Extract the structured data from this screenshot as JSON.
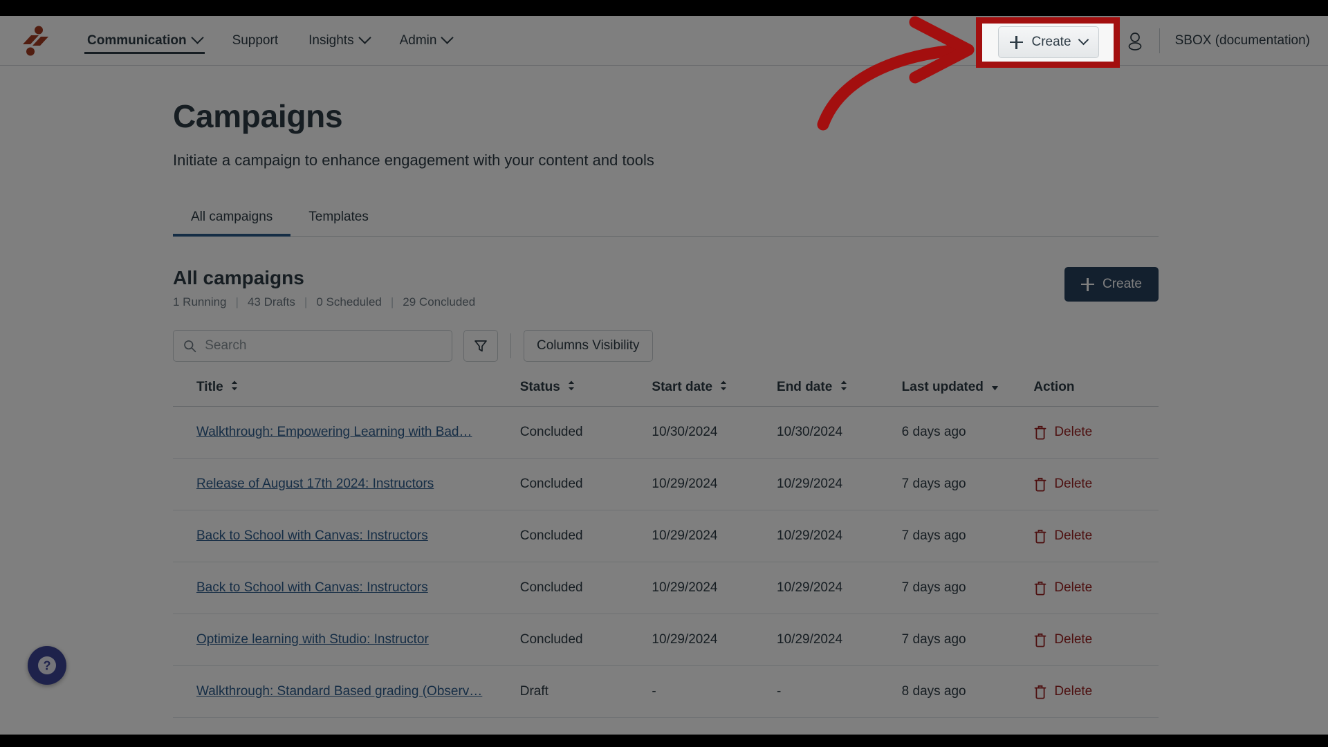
{
  "topnav": {
    "brand_icon": "brand-logo-icon",
    "links": [
      {
        "label": "Communication",
        "has_caret": true,
        "active": true
      },
      {
        "label": "Support",
        "has_caret": false,
        "active": false
      },
      {
        "label": "Insights",
        "has_caret": true,
        "active": false
      },
      {
        "label": "Admin",
        "has_caret": true,
        "active": false
      }
    ],
    "create_label": "Create",
    "account_name": "SBOX (documentation)"
  },
  "page": {
    "title": "Campaigns",
    "subtitle": "Initiate a campaign to enhance engagement with your content and tools",
    "tabs": [
      {
        "label": "All campaigns",
        "active": true
      },
      {
        "label": "Templates",
        "active": false
      }
    ],
    "section_title": "All campaigns",
    "stats": [
      "1 Running",
      "43 Drafts",
      "0 Scheduled",
      "29 Concluded"
    ],
    "stats_separator": "|",
    "create_button_label": "Create"
  },
  "toolbar": {
    "search_placeholder": "Search",
    "search_value": "",
    "filter_icon": "filter-funnel-icon",
    "columns_visibility_label": "Columns Visibility"
  },
  "table": {
    "columns": [
      {
        "label": "Title",
        "sort": "both"
      },
      {
        "label": "Status",
        "sort": "both"
      },
      {
        "label": "Start date",
        "sort": "both"
      },
      {
        "label": "End date",
        "sort": "both"
      },
      {
        "label": "Last updated",
        "sort": "desc"
      },
      {
        "label": "Action",
        "sort": "none"
      }
    ],
    "rows": [
      {
        "title": "Walkthrough: Empowering Learning with Bad…",
        "status": "Concluded",
        "start_date": "10/30/2024",
        "end_date": "10/30/2024",
        "last_updated": "6 days ago",
        "action": "Delete"
      },
      {
        "title": "Release of August 17th 2024: Instructors",
        "status": "Concluded",
        "start_date": "10/29/2024",
        "end_date": "10/29/2024",
        "last_updated": "7 days ago",
        "action": "Delete"
      },
      {
        "title": "Back to School with Canvas: Instructors",
        "status": "Concluded",
        "start_date": "10/29/2024",
        "end_date": "10/29/2024",
        "last_updated": "7 days ago",
        "action": "Delete"
      },
      {
        "title": "Back to School with Canvas: Instructors",
        "status": "Concluded",
        "start_date": "10/29/2024",
        "end_date": "10/29/2024",
        "last_updated": "7 days ago",
        "action": "Delete"
      },
      {
        "title": "Optimize learning with Studio: Instructor",
        "status": "Concluded",
        "start_date": "10/29/2024",
        "end_date": "10/29/2024",
        "last_updated": "7 days ago",
        "action": "Delete"
      },
      {
        "title": "Walkthrough: Standard Based grading (Observ…",
        "status": "Draft",
        "start_date": "-",
        "end_date": "-",
        "last_updated": "8 days ago",
        "action": "Delete"
      }
    ]
  },
  "help": {
    "icon": "question-mark-icon"
  },
  "annotation": {
    "highlight_target": "create-button-top",
    "create_label": "Create",
    "arrow_color": "#a30f0f",
    "box_color": "#a30f0f"
  },
  "colors": {
    "brand": "#a33b21",
    "link": "#2b5a8b",
    "primary_button": "#27415d",
    "danger": "#9b2020",
    "text": "#2d3b45",
    "muted": "#6b7780",
    "annotation_red": "#a30f0f",
    "help_purple": "#3c4497"
  }
}
